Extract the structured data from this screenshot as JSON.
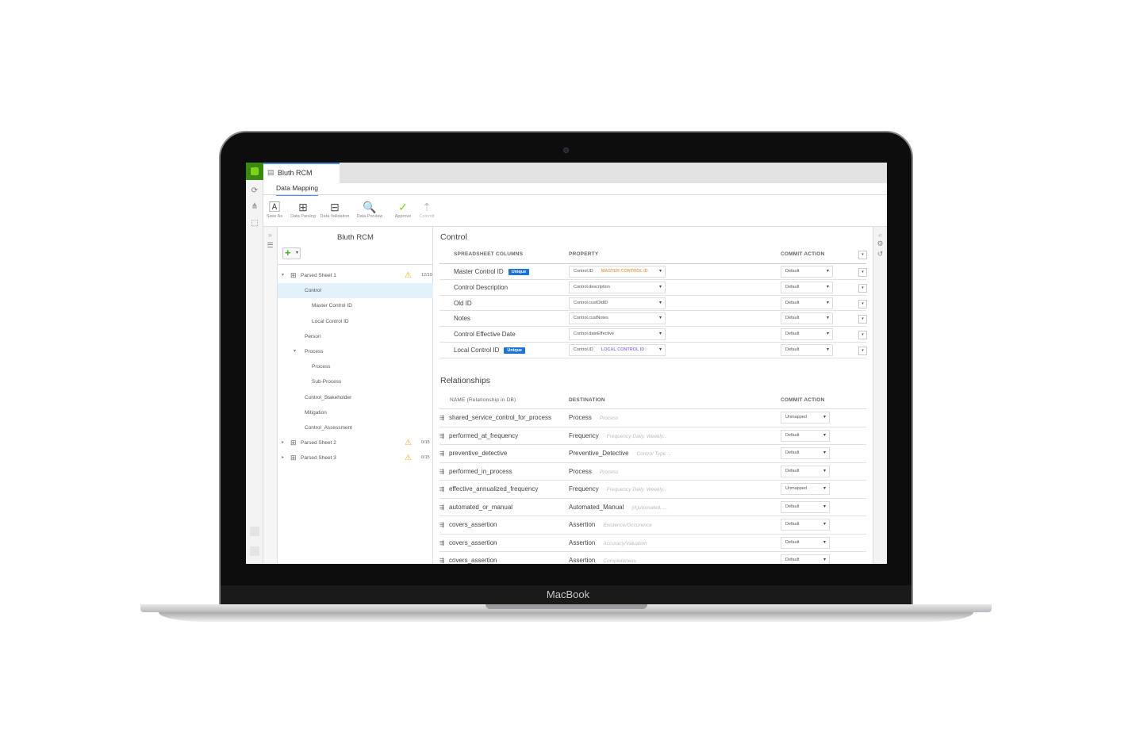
{
  "device": {
    "brand": "MacBook"
  },
  "app": {
    "tab_title": "Bluth RCM",
    "subtab": "Data Mapping",
    "toolbar": [
      {
        "label": "Save As",
        "icon": "save-as-icon"
      },
      {
        "label": "Data Parsing",
        "icon": "table-icon"
      },
      {
        "label": "Data Validation",
        "icon": "validation-icon"
      },
      {
        "label": "Data Preview",
        "icon": "preview-icon"
      },
      {
        "label": "Approve",
        "icon": "approve-icon"
      },
      {
        "label": "Commit",
        "icon": "commit-icon"
      }
    ]
  },
  "tree": {
    "title": "Bluth RCM",
    "items": [
      {
        "label": "Parsed Sheet 1",
        "level": 0,
        "expanded": true,
        "warning": true,
        "count": "12/19"
      },
      {
        "label": "Control",
        "level": 1,
        "selected": true
      },
      {
        "label": "Master Control ID",
        "level": 2
      },
      {
        "label": "Local Control ID",
        "level": 2
      },
      {
        "label": "Person",
        "level": 1
      },
      {
        "label": "Process",
        "level": 1,
        "expanded": true
      },
      {
        "label": "Process",
        "level": 2
      },
      {
        "label": "Sub-Process",
        "level": 2
      },
      {
        "label": "Control_Stakeholder",
        "level": 1
      },
      {
        "label": "Mitigation",
        "level": 1
      },
      {
        "label": "Control_Assessment",
        "level": 1
      },
      {
        "label": "Parsed Sheet 2",
        "level": 0,
        "expanded": false,
        "warning": true,
        "count": "0/15"
      },
      {
        "label": "Parsed Sheet 3",
        "level": 0,
        "expanded": false,
        "warning": true,
        "count": "0/15"
      }
    ]
  },
  "control": {
    "title": "Control",
    "headers": {
      "columns": "SPREADSHEET COLUMNS",
      "property": "PROPERTY",
      "commit": "COMMIT ACTION"
    },
    "rows": [
      {
        "column": "Master Control ID",
        "badge": "Unique",
        "property": "Control.ID",
        "hint": "MASTER CONTROL ID",
        "hint_color": "#e8a55a",
        "commit": "Default"
      },
      {
        "column": "Control Description",
        "property": "Control.description",
        "commit": "Default"
      },
      {
        "column": "Old ID",
        "property": "Control.custOldID",
        "commit": "Default"
      },
      {
        "column": "Notes",
        "property": "Control.custNotes",
        "commit": "Default"
      },
      {
        "column": "Control Effective Date",
        "property": "Control.dateEffective",
        "commit": "Default"
      },
      {
        "column": "Local Control ID",
        "badge": "Unique",
        "property": "Control.ID",
        "hint": "LOCAL CONTROL ID",
        "hint_color": "#9b7fe6",
        "commit": "Default"
      }
    ]
  },
  "relationships": {
    "title": "Relationships",
    "headers": {
      "name": "NAME (Relationship in DB)",
      "destination": "DESTINATION",
      "commit": "COMMIT ACTION"
    },
    "rows": [
      {
        "name": "shared_service_control_for_process",
        "destination": "Process",
        "hint": "Process",
        "commit": "Unmapped"
      },
      {
        "name": "performed_at_frequency",
        "destination": "Frequency",
        "hint": "Frequency Daily, Weekly...",
        "commit": "Default"
      },
      {
        "name": "preventive_detective",
        "destination": "Preventive_Detective",
        "hint": "Control Type ...",
        "commit": "Default"
      },
      {
        "name": "performed_in_process",
        "destination": "Process",
        "hint": "Process",
        "commit": "Default"
      },
      {
        "name": "effective_annualized_frequency",
        "destination": "Frequency",
        "hint": "Frequency Daily, Weekly...",
        "commit": "Unmapped"
      },
      {
        "name": "automated_or_manual",
        "destination": "Automated_Manual",
        "hint": "(A)utomated, ...",
        "commit": "Default"
      },
      {
        "name": "covers_assertion",
        "destination": "Assertion",
        "hint": "Existence/Occurence",
        "commit": "Default"
      },
      {
        "name": "covers_assertion",
        "destination": "Assertion",
        "hint": "Accuracy/Valuation",
        "commit": "Default"
      },
      {
        "name": "covers_assertion",
        "destination": "Assertion",
        "hint": "Completeness",
        "commit": "Default"
      }
    ]
  },
  "colors": {
    "brand_green": "#3a8a10",
    "accent_blue": "#4a90e2",
    "badge_blue": "#1a73d9",
    "warning": "#f5a623",
    "selected_row": "#e3f1fc"
  }
}
